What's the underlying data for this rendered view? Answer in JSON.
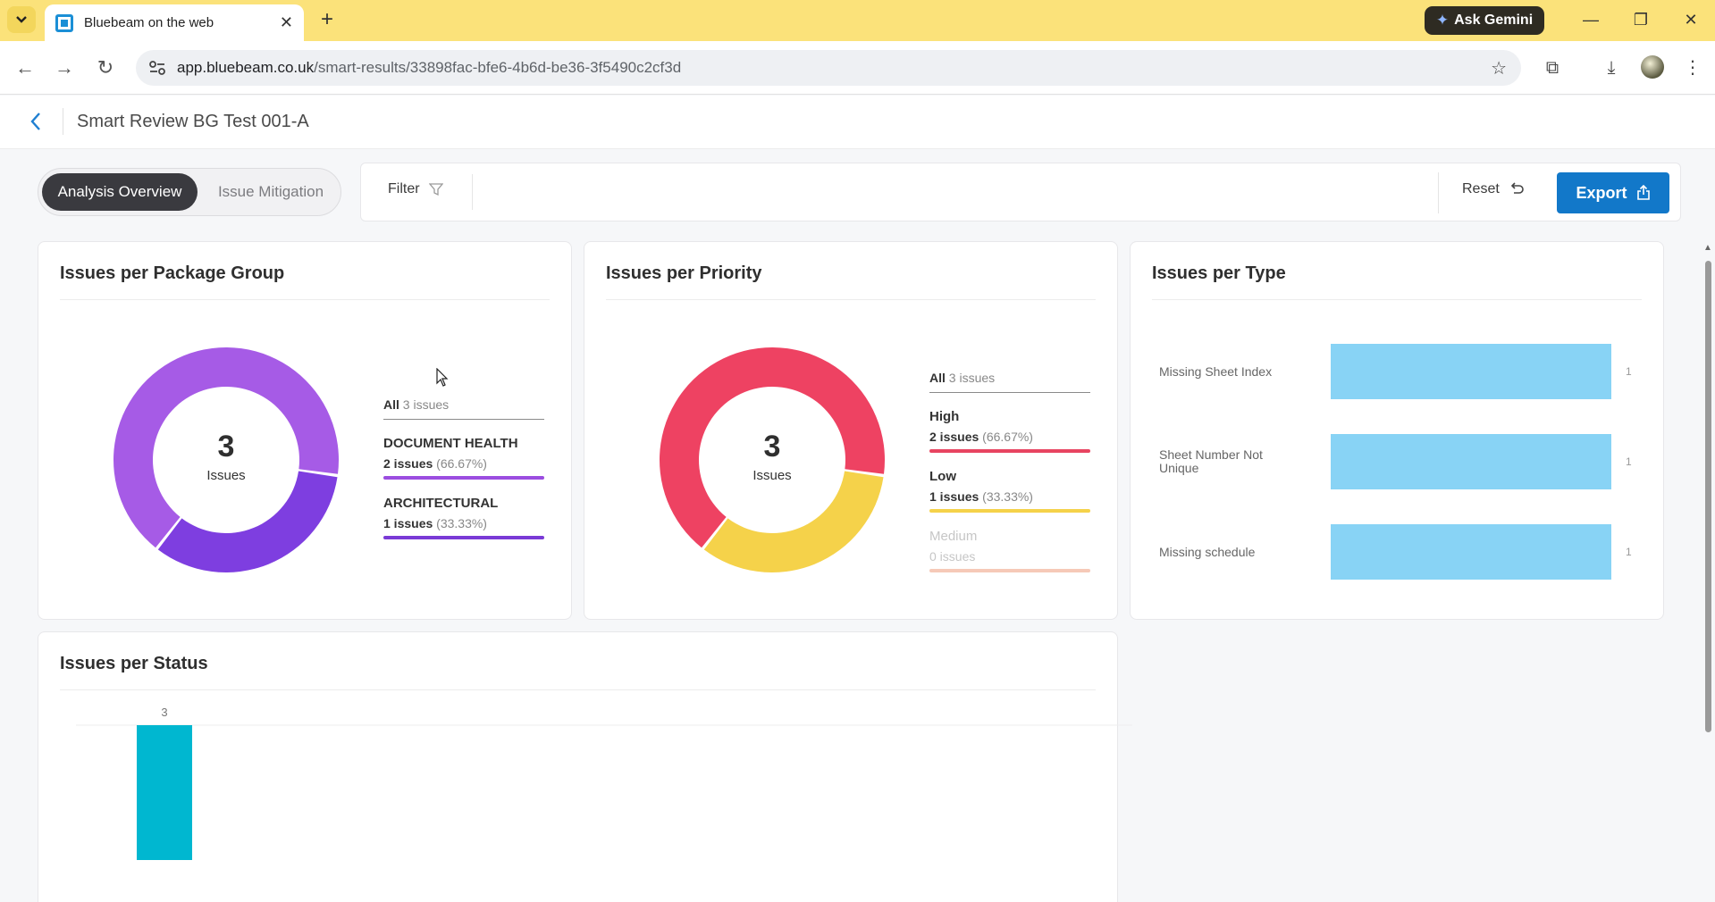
{
  "browser": {
    "tab_title": "Bluebeam on the web",
    "new_tab": "+",
    "ask_gemini": "Ask Gemini",
    "url_host": "app.bluebeam.co.uk",
    "url_path": "/smart-results/33898fac-bfe6-4b6d-be36-3f5490c2cf3d",
    "colors": {
      "tabbar": "#fbe27a",
      "gemini": "#2e2b22"
    }
  },
  "header": {
    "title": "Smart Review BG Test 001-A"
  },
  "toolbar": {
    "tabs": [
      "Analysis Overview",
      "Issue Mitigation"
    ],
    "active_tab": "Analysis Overview",
    "filter_label": "Filter",
    "reset_label": "Reset",
    "export_label": "Export",
    "colors": {
      "export": "#1278c9"
    }
  },
  "package_group": {
    "title": "Issues per Package Group",
    "total": "3",
    "total_label": "Issues",
    "all_label": "All",
    "all_count": "3 issues",
    "items": [
      {
        "name": "DOCUMENT HEALTH",
        "count": "2 issues",
        "pct": "(66.67%)",
        "color": "#9b4de0"
      },
      {
        "name": "ARCHITECTURAL",
        "count": "1 issues",
        "pct": "(33.33%)",
        "color": "#7a3ad6"
      }
    ]
  },
  "priority": {
    "title": "Issues per Priority",
    "total": "3",
    "total_label": "Issues",
    "all_label": "All",
    "all_count": "3 issues",
    "items": [
      {
        "name": "High",
        "count": "2 issues",
        "pct": "(66.67%)",
        "color": "#ee4262"
      },
      {
        "name": "Low",
        "count": "1 issues",
        "pct": "(33.33%)",
        "color": "#f5d24a"
      },
      {
        "name": "Medium",
        "count": "0 issues",
        "pct": "",
        "color": "#f6c9b8"
      }
    ]
  },
  "type": {
    "title": "Issues per Type",
    "items": [
      {
        "label": "Missing Sheet Index",
        "value": "1"
      },
      {
        "label": "Sheet Number Not Unique",
        "value": "1"
      },
      {
        "label": "Missing schedule",
        "value": "1"
      }
    ],
    "color": "#88d3f5"
  },
  "status": {
    "title": "Issues per Status"
  },
  "chart_data": [
    {
      "type": "pie",
      "title": "Issues per Package Group",
      "labels": [
        "DOCUMENT HEALTH",
        "ARCHITECTURAL"
      ],
      "values": [
        2,
        1
      ],
      "colors": [
        "#a65be6",
        "#7e3ee0"
      ],
      "donut": true
    },
    {
      "type": "pie",
      "title": "Issues per Priority",
      "labels": [
        "High",
        "Low",
        "Medium"
      ],
      "values": [
        2,
        1,
        0
      ],
      "colors": [
        "#ee4262",
        "#f5d24a",
        "#f6c9b8"
      ],
      "donut": true
    },
    {
      "type": "bar",
      "title": "Issues per Type",
      "orientation": "horizontal",
      "categories": [
        "Missing Sheet Index",
        "Sheet Number Not Unique",
        "Missing schedule"
      ],
      "values": [
        1,
        1,
        1
      ],
      "xlim": [
        0,
        1
      ]
    },
    {
      "type": "bar",
      "title": "Issues per Status",
      "categories": [
        ""
      ],
      "values": [
        3
      ],
      "data_labels": [
        "3"
      ],
      "color": "#00b7d0",
      "ylim": [
        0,
        3
      ]
    }
  ]
}
